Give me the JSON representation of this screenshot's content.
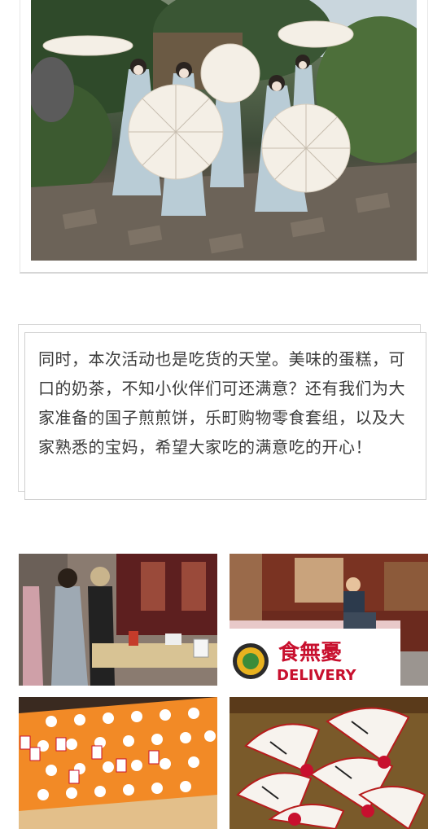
{
  "article": {
    "paragraph": "同时，本次活动也是吃货的天堂。美味的蛋糕，可口的奶茶，不知小伙伴们可还满意？还有我们为大家准备的国子煎煎饼，乐町购物零食套组，以及大家熟悉的宝妈，希望大家吃的满意吃的开心！"
  },
  "photos": {
    "top": {
      "subject": "five women in hanfu holding paper parasols in a garden"
    },
    "grid": [
      {
        "subject": "two women at a dessert table"
      },
      {
        "subject": "food delivery booth",
        "sign_title": "食無憂",
        "sign_subtitle": "DELIVERY"
      },
      {
        "subject": "cake with small decorations on orange platter"
      },
      {
        "subject": "red and white folding fans with calligraphy"
      }
    ]
  },
  "colors": {
    "text": "#3b3b3b",
    "border": "#cfcfcf",
    "sign_red": "#c8102e"
  }
}
